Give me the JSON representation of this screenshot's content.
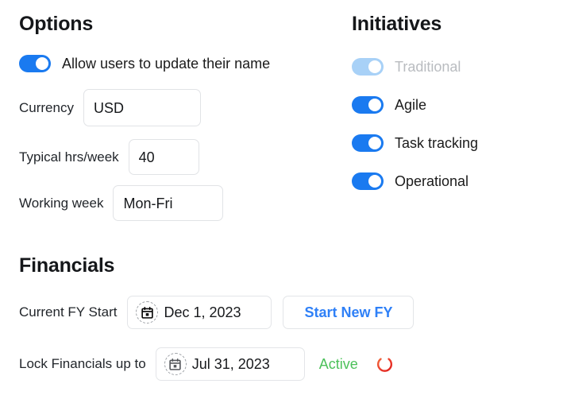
{
  "options": {
    "heading": "Options",
    "allow_rename": {
      "label": "Allow users to update their name",
      "state": "on"
    },
    "fields": [
      {
        "label": "Currency",
        "value": "USD"
      },
      {
        "label": "Typical hrs/week",
        "value": "40"
      },
      {
        "label": "Working week",
        "value": "Mon-Fri"
      }
    ]
  },
  "initiatives": {
    "heading": "Initiatives",
    "items": [
      {
        "label": "Traditional",
        "state": "on",
        "disabled": true
      },
      {
        "label": "Agile",
        "state": "on",
        "disabled": false
      },
      {
        "label": "Task tracking",
        "state": "on",
        "disabled": false
      },
      {
        "label": "Operational",
        "state": "on",
        "disabled": false
      }
    ]
  },
  "financials": {
    "heading": "Financials",
    "current_fy": {
      "label": "Current FY Start",
      "date": "Dec 1, 2023",
      "calendar_icon": "calendar-icon",
      "button_label": "Start New FY"
    },
    "lock": {
      "label": "Lock Financials up to",
      "date": "Jul 31, 2023",
      "calendar_icon": "calendar-icon",
      "status": "Active",
      "power_icon": "power-icon"
    }
  },
  "colors": {
    "toggle_on": "#1a7af0",
    "toggle_disabled": "#a8d1f7",
    "accent_link": "#2f80f7",
    "status_active": "#4cc15a",
    "power_icon": "#e8332a",
    "border": "#e3e5e8",
    "text": "#16181b",
    "text_muted": "#b9bcc0"
  }
}
